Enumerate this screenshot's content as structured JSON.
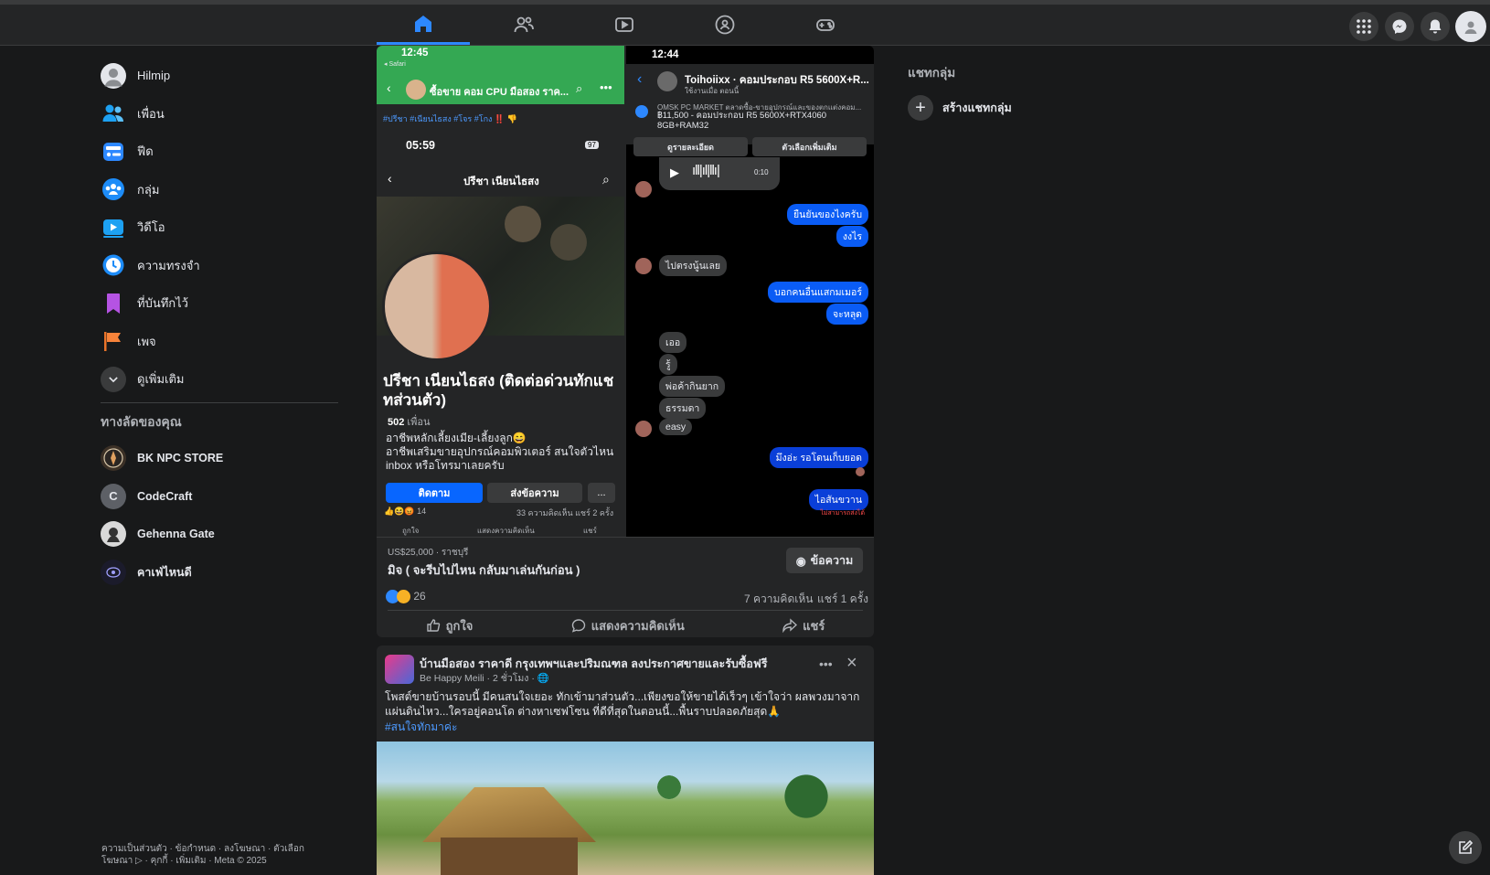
{
  "topnav": {
    "tabs": [
      "home-icon",
      "friends-icon",
      "watch-icon",
      "groups-icon",
      "gaming-icon"
    ],
    "right": [
      "menu-grid-icon",
      "messenger-icon",
      "notifications-icon",
      "profile-avatar"
    ]
  },
  "sidebar": {
    "items": [
      {
        "label": "Hilmip",
        "icon": "avatar"
      },
      {
        "label": "เพื่อน",
        "icon": "friends-icon"
      },
      {
        "label": "ฟีด",
        "icon": "feed-icon"
      },
      {
        "label": "กลุ่ม",
        "icon": "groups-icon"
      },
      {
        "label": "วิดีโอ",
        "icon": "video-icon"
      },
      {
        "label": "ความทรงจำ",
        "icon": "memories-icon"
      },
      {
        "label": "ที่บันทึกไว้",
        "icon": "saved-icon"
      },
      {
        "label": "เพจ",
        "icon": "pages-icon"
      },
      {
        "label": "ดูเพิ่มเติม",
        "icon": "chevron-down-icon"
      }
    ],
    "shortcuts_title": "ทางลัดของคุณ",
    "shortcuts": [
      "BK NPC STORE",
      "CodeCraft",
      "Gehenna Gate",
      "คาเฟ่ไหนดี"
    ],
    "footer": "ความเป็นส่วนตัว · ข้อกำหนด · ลงโฆษณา · ตัวเลือกโฆษณา ▷ · คุกกี้ · เพิ่มเติม · Meta © 2025"
  },
  "post1": {
    "left_shot": {
      "time": "12:45",
      "back_label": "◂ Safari",
      "header": "ซื้อขาย คอม CPU มือสอง ราค...",
      "tags": "#ปรีชา #เนียนไธสง #โจร #โกง ‼️ 👎",
      "inner_time": "05:59",
      "battery": "97",
      "profile_title": "ปรีชา เนียนไธสง",
      "name": "ปรีชา เนียนไธสง (ติดต่อด่วนทักแชทส่วนตัว)",
      "friends_count": "502",
      "friends_label": "เพื่อน",
      "bio1": "อาชีพหลักเลี้ยงเมีย-เลี้ยงลูก😄",
      "bio2": "อาชีพเสริมขายอุปกรณ์คอมพิวเตอร์ สนใจตัวไหน inbox หรือโทรมาเลยครับ",
      "follow": "ติดตาม",
      "message": "ส่งข้อความ",
      "more": "...",
      "reactions": "14",
      "stats": "33 ความคิดเห็น แชร์ 2 ครั้ง",
      "mini_actions": [
        "ถูกใจ",
        "แสดงความคิดเห็น",
        "แชร์"
      ]
    },
    "right_shot": {
      "time": "12:44",
      "chat_name": "Toihoiixx · คอมประกอบ R5 5600X+R...",
      "chat_sub": "ใช้งานเมื่อ ตอนนี้",
      "market": "OMSK PC MARKET ตลาดซื้อ-ขายอุปกรณ์และของตกแต่งคอม...",
      "price_line": "฿11,500 - คอมประกอบ R5 5600X+RTX4060 8GB+RAM32",
      "btn_detail": "ดูรายละเอียด",
      "btn_more": "ตัวเลือกเพิ่มเติม",
      "audio_len": "0:10",
      "msgs_right_1": [
        "ยืนยันของไงครับ",
        "งงไร"
      ],
      "msg_left_1": "ไปตรงนู้นเลย",
      "msgs_right_2": [
        "บอกคนอื่นแสกมเมอร์",
        "จะหลุด"
      ],
      "msgs_left_2": [
        "เออ",
        "รู้",
        "พ่อค้ากินยาก",
        "ธรรมดา",
        "easy"
      ],
      "msg_right_3": "มึงอ่ะ รอโดนเก็บยอด",
      "msg_right_4": "ไอสันขวาน",
      "not_sent": "ไม่สามารถส่งได้"
    },
    "listing_price": "US$25,000 · ราชบุรี",
    "listing_title": "มิจ ( จะรีบไปไหน กลับมาเล่นกันก่อน )",
    "message_btn": "ข้อความ",
    "reaction_count": "26",
    "comments": "7 ความคิดเห็น",
    "shares": "แชร์ 1 ครั้ง",
    "like": "ถูกใจ",
    "comment": "แสดงความคิดเห็น",
    "share": "แชร์"
  },
  "post2": {
    "page_name": "บ้านมือสอง ราคาดี กรุงเทพฯและปริมณฑล ลงประกาศขายและรับซื้อฟรี",
    "author": "Be Happy Meili · 2 ชั่วโมง · 🌐",
    "text": "โพสต์ขายบ้านรอบนี้ มีคนสนใจเยอะ ทักเข้ามาส่วนตัว...เพียงขอให้ขายได้เร็วๆ เข้าใจว่า ผลพวงมาจากแผ่นดินไหว...ใครอยู่คอนโด ต่างหาเซฟโซน ที่ดีที่สุดในตอนนี้...พื้นราบปลอดภัยสุด🙏",
    "hashtag": "#สนใจทักมาค่ะ"
  },
  "right_col": {
    "title": "แชทกลุ่ม",
    "create": "สร้างแชทกลุ่ม"
  }
}
